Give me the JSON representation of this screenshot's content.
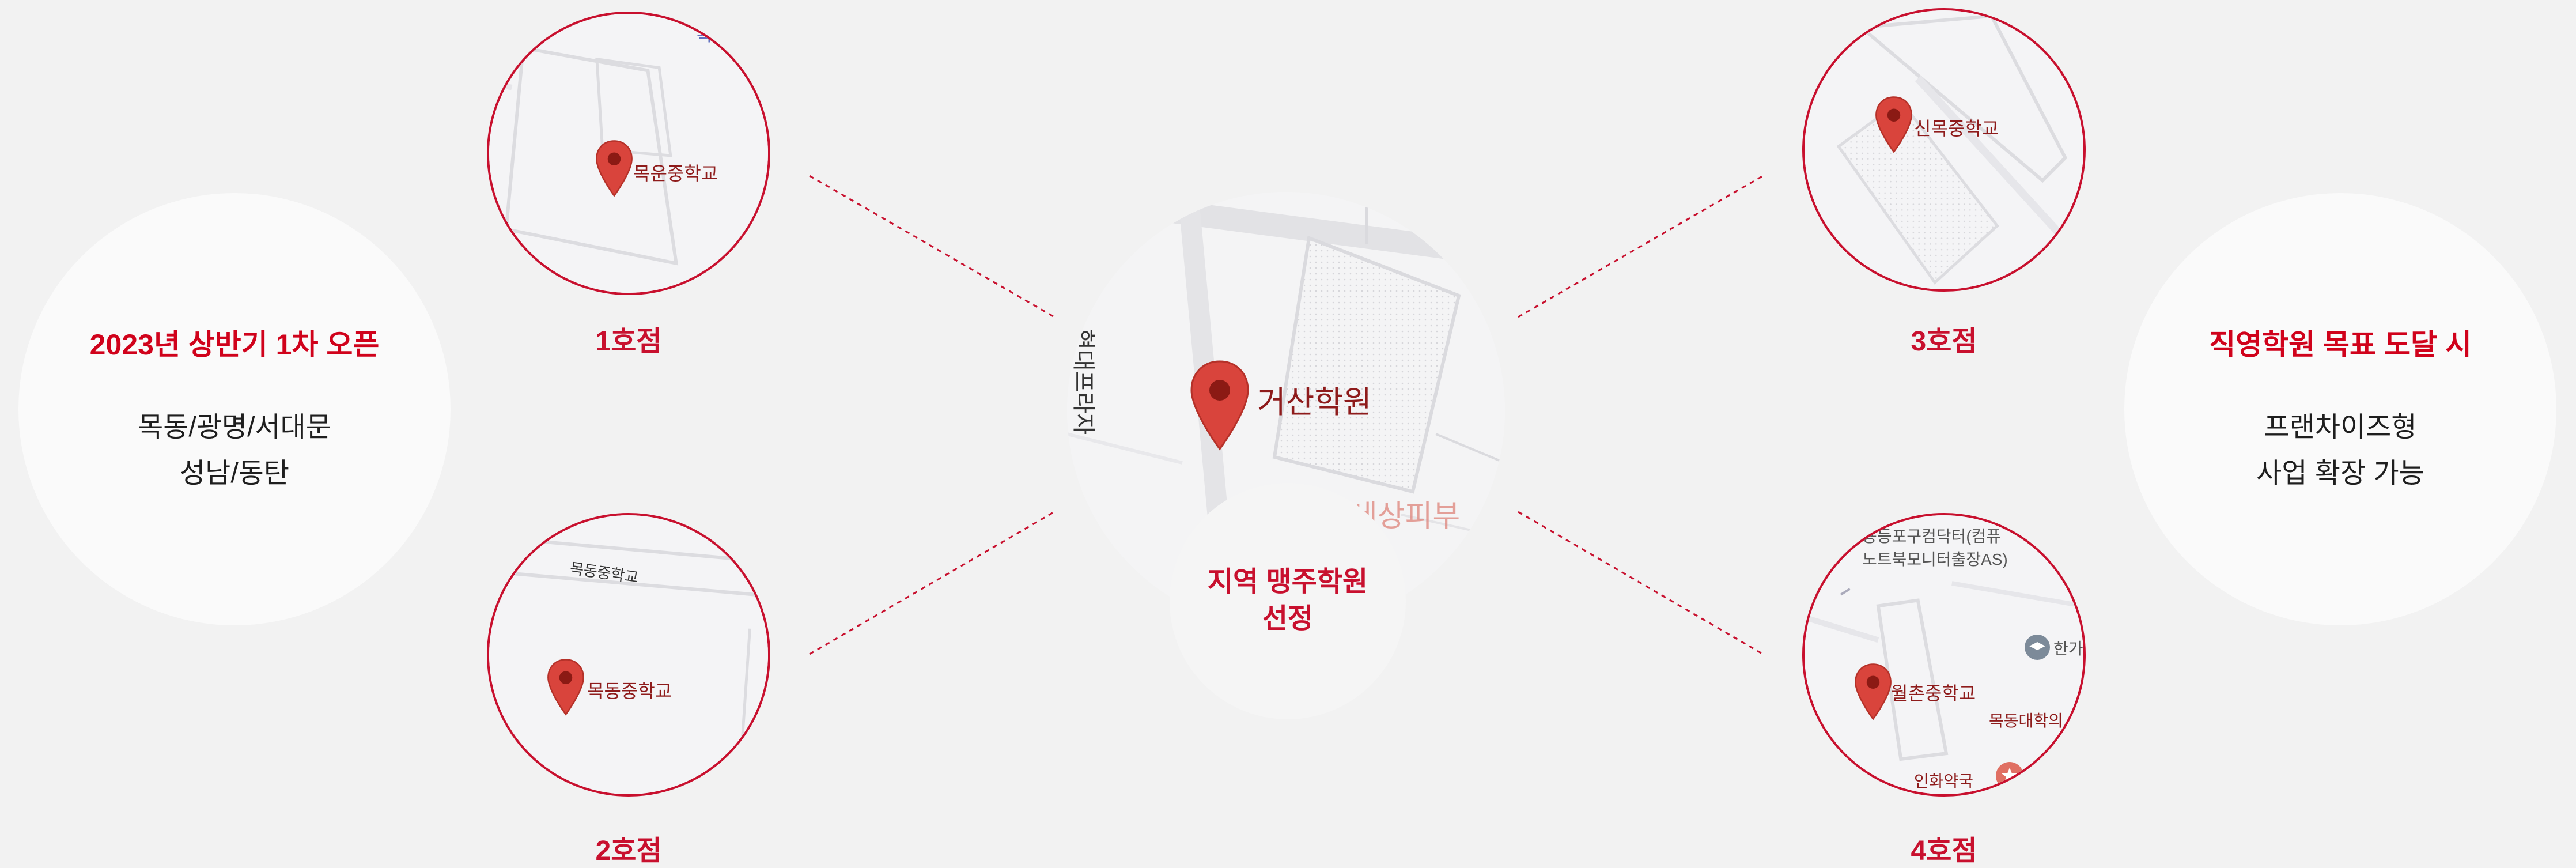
{
  "left_info": {
    "title": "2023년 상반기 1차 오픈",
    "lines": [
      "목동/광명/서대문",
      "성남/동탄"
    ]
  },
  "right_info": {
    "title": "직영학원 목표 도달 시",
    "lines": [
      "프랜차이즈형",
      "사업 확장 가능"
    ]
  },
  "center": {
    "pin_label": "거산학원",
    "road_label": "현대프라자",
    "faded_label": "목동 고운세상피부",
    "caption_lines": [
      "지역 맹주학원",
      "선정"
    ]
  },
  "branches": [
    {
      "label": "1호점",
      "pin_label": "목운중학교",
      "edge_text": "목"
    },
    {
      "label": "2호점",
      "pin_label": "목동중학교",
      "street": "목동중학교"
    },
    {
      "label": "3호점",
      "pin_label": "신목중학교"
    },
    {
      "label": "4호점",
      "pin_label": "월촌중학교",
      "extra": [
        "용등포구컴닥터(컴퓨",
        "노트북모니터출장AS)",
        "한가",
        "목동대학의",
        "인화약국"
      ]
    }
  ],
  "colors": {
    "accent": "#c8102e",
    "pin": "#d9443c",
    "background": "#f2f2f2"
  }
}
